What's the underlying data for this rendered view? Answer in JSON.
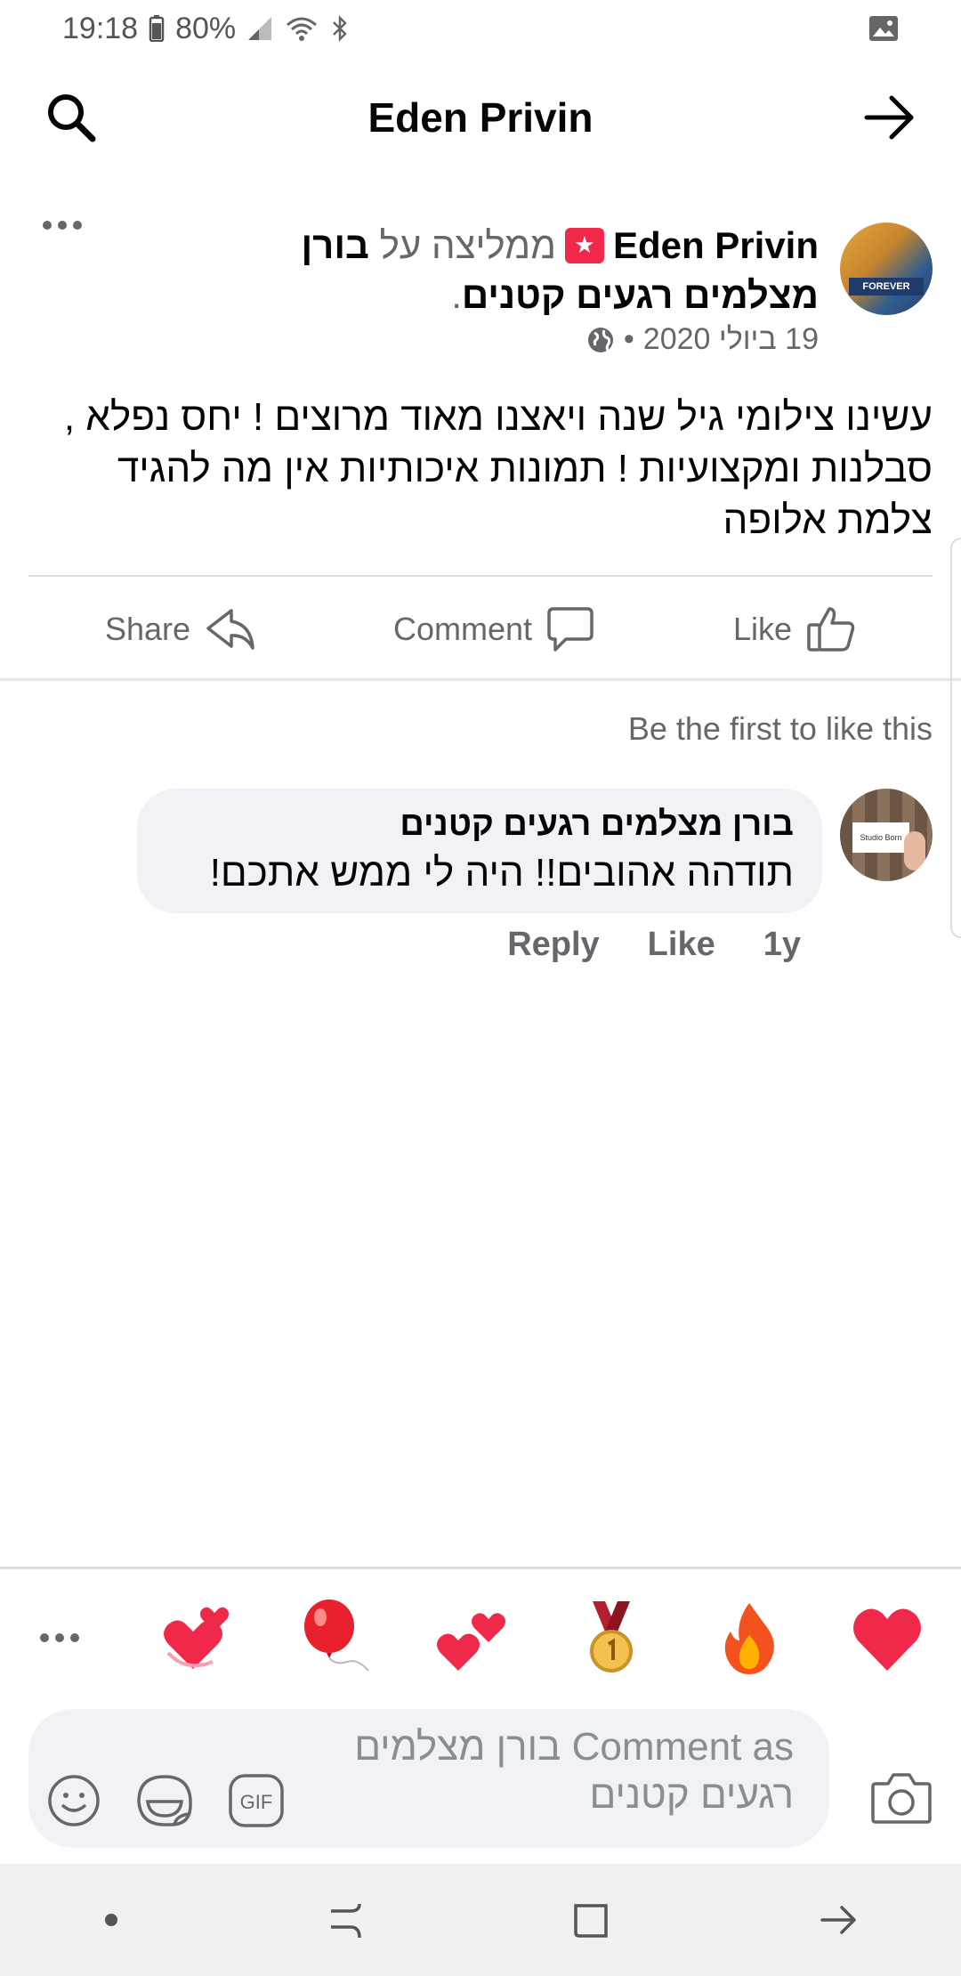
{
  "status_bar": {
    "time": "19:18",
    "battery": "80%",
    "icons": [
      "battery-icon",
      "signal-icon",
      "wifi-icon",
      "bluetooth-icon",
      "gallery-icon"
    ]
  },
  "header": {
    "title": "Eden Privin",
    "search_icon": "search-icon",
    "forward_icon": "arrow-right-icon"
  },
  "post": {
    "author": "Eden Privin",
    "verb": "ממליצה על",
    "page_name": "בורן מצלמים רגעים קטנים",
    "end_dot": ".",
    "date": "19 ביולי 2020",
    "separator": "•",
    "privacy_icon": "globe-icon",
    "avatar_caption": "FOREVER",
    "body": "עשינו צילומי גיל שנה ויאצנו מאוד מרוצים ! יחס נפלא , סבלנות ומקצועיות ! תמונות איכותיות אין מה להגיד צלמת אלופה",
    "actions": {
      "share": "Share",
      "comment": "Comment",
      "like": "Like"
    }
  },
  "likes_summary": "Be the first to like this",
  "comment": {
    "author": "בורן מצלמים רגעים קטנים",
    "text": "תודהה  אהובים!! היה לי ממש  אתכם!",
    "avatar_caption": "Studio Born",
    "actions": {
      "reply": "Reply",
      "like": "Like",
      "time": "1y"
    }
  },
  "reactions": [
    "more-icon",
    "two-hearts-icon",
    "balloon-icon",
    "hearts-icon",
    "medal-icon",
    "fire-icon",
    "heart-icon"
  ],
  "composer": {
    "placeholder": "Comment as בורן מצלמים רגעים קטנים",
    "gif_label": "GIF"
  },
  "colors": {
    "text": "#050505",
    "secondary": "#65676b",
    "bubble": "#f0f2f5",
    "red": "#f02849"
  }
}
